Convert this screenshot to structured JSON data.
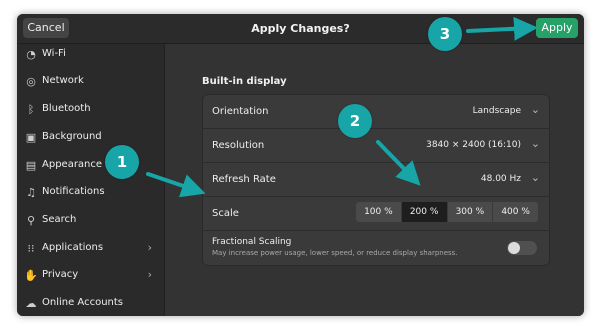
{
  "header": {
    "cancel_label": "Cancel",
    "title": "Apply Changes?",
    "apply_label": "Apply"
  },
  "sidebar": {
    "items": [
      {
        "label": "Wi-Fi",
        "icon": "wifi-icon",
        "glyph": "◔",
        "chevron": false
      },
      {
        "label": "Network",
        "icon": "network-icon",
        "glyph": "◎",
        "chevron": false
      },
      {
        "label": "Bluetooth",
        "icon": "bluetooth-icon",
        "glyph": "ᛒ",
        "chevron": false
      },
      {
        "label": "Background",
        "icon": "background-icon",
        "glyph": "▣",
        "chevron": false
      },
      {
        "label": "Appearance",
        "icon": "appearance-icon",
        "glyph": "▤",
        "chevron": false
      },
      {
        "label": "Notifications",
        "icon": "bell-icon",
        "glyph": "♫",
        "chevron": false
      },
      {
        "label": "Search",
        "icon": "search-icon",
        "glyph": "⚲",
        "chevron": false
      },
      {
        "label": "Applications",
        "icon": "apps-grid-icon",
        "glyph": "⁝⁝",
        "chevron": true
      },
      {
        "label": "Privacy",
        "icon": "privacy-icon",
        "glyph": "✋",
        "chevron": true
      },
      {
        "label": "Online Accounts",
        "icon": "cloud-icon",
        "glyph": "☁",
        "chevron": false
      }
    ],
    "chevron_glyph": "›"
  },
  "display": {
    "section_title": "Built-in display",
    "orientation": {
      "label": "Orientation",
      "value": "Landscape"
    },
    "resolution": {
      "label": "Resolution",
      "value": "3840 × 2400 (16:10)"
    },
    "refresh_rate": {
      "label": "Refresh Rate",
      "value": "48.00 Hz"
    },
    "scale": {
      "label": "Scale",
      "options": [
        "100 %",
        "200 %",
        "300 %",
        "400 %"
      ],
      "selected": "200 %"
    },
    "fractional_scaling": {
      "label": "Fractional Scaling",
      "description": "May increase power usage, lower speed, or reduce display sharpness.",
      "enabled": false
    },
    "chevron_glyph": "⌄"
  },
  "annotations": {
    "badge_1": "1",
    "badge_2": "2",
    "badge_3": "3"
  },
  "colors": {
    "apply_green": "#26a269",
    "badge_teal": "#17a5a8",
    "window_bg": "#2f2f2f"
  }
}
